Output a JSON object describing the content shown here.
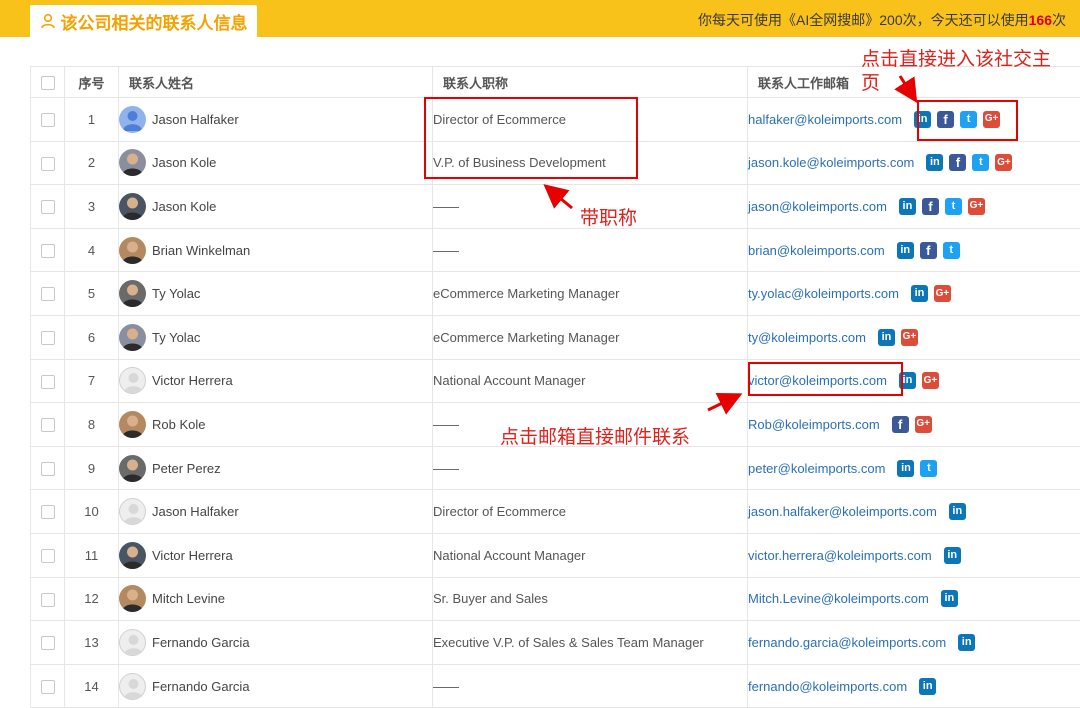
{
  "header": {
    "tab_label": "该公司相关的联系人信息",
    "quota_prefix": "你每天可使用《AI全网搜邮》200次，今天还可以使用",
    "quota_remaining": "166",
    "quota_suffix": "次"
  },
  "table": {
    "columns": {
      "index": "序号",
      "name": "联系人姓名",
      "title": "联系人职称",
      "email": "联系人工作邮箱"
    },
    "rows": [
      {
        "no": "1",
        "name": "Jason Halfaker",
        "title": "Director of Ecommerce",
        "email": "halfaker@koleimports.com",
        "avatar": "default-blue",
        "social": [
          "in",
          "f",
          "t",
          "g+"
        ]
      },
      {
        "no": "2",
        "name": "Jason Kole",
        "title": "V.P. of Business Development",
        "email": "jason.kole@koleimports.com",
        "avatar": "photo",
        "social": [
          "in",
          "f",
          "t",
          "g+"
        ]
      },
      {
        "no": "3",
        "name": "Jason Kole",
        "title": "——",
        "email": "jason@koleimports.com",
        "avatar": "photo",
        "social": [
          "in",
          "f",
          "t",
          "g+"
        ]
      },
      {
        "no": "4",
        "name": "Brian Winkelman",
        "title": "——",
        "email": "brian@koleimports.com",
        "avatar": "photo",
        "social": [
          "in",
          "f",
          "t"
        ]
      },
      {
        "no": "5",
        "name": "Ty Yolac",
        "title": "eCommerce Marketing Manager",
        "email": "ty.yolac@koleimports.com",
        "avatar": "photo",
        "social": [
          "in",
          "g+"
        ]
      },
      {
        "no": "6",
        "name": "Ty Yolac",
        "title": "eCommerce Marketing Manager",
        "email": "ty@koleimports.com",
        "avatar": "photo",
        "social": [
          "in",
          "g+"
        ]
      },
      {
        "no": "7",
        "name": "Victor Herrera",
        "title": "National Account Manager",
        "email": "victor@koleimports.com",
        "avatar": "default-gray",
        "social": [
          "in",
          "g+"
        ]
      },
      {
        "no": "8",
        "name": "Rob Kole",
        "title": "——",
        "email": "Rob@koleimports.com",
        "avatar": "photo",
        "social": [
          "f",
          "g+"
        ]
      },
      {
        "no": "9",
        "name": "Peter Perez",
        "title": "——",
        "email": "peter@koleimports.com",
        "avatar": "photo",
        "social": [
          "in",
          "t"
        ]
      },
      {
        "no": "10",
        "name": "Jason Halfaker",
        "title": "Director of Ecommerce",
        "email": "jason.halfaker@koleimports.com",
        "avatar": "default-gray",
        "social": [
          "in"
        ]
      },
      {
        "no": "11",
        "name": "Victor Herrera",
        "title": "National Account Manager",
        "email": "victor.herrera@koleimports.com",
        "avatar": "photo",
        "social": [
          "in"
        ]
      },
      {
        "no": "12",
        "name": "Mitch Levine",
        "title": "Sr. Buyer and Sales",
        "email": "Mitch.Levine@koleimports.com",
        "avatar": "photo",
        "social": [
          "in"
        ]
      },
      {
        "no": "13",
        "name": "Fernando Garcia",
        "title": "Executive V.P. of Sales & Sales Team Manager",
        "email": "fernando.garcia@koleimports.com",
        "avatar": "default-gray",
        "social": [
          "in"
        ]
      },
      {
        "no": "14",
        "name": "Fernando Garcia",
        "title": "——",
        "email": "fernando@koleimports.com",
        "avatar": "default-gray",
        "social": [
          "in"
        ]
      }
    ]
  },
  "annotations": {
    "social_note": "点击直接进入该社交主页",
    "title_note": "带职称",
    "email_note": "点击邮箱直接邮件联系"
  },
  "colors": {
    "accent": "#f9c21b",
    "tab_text": "#f5a200",
    "link": "#2a6fb7",
    "annotation": "#e60000"
  }
}
